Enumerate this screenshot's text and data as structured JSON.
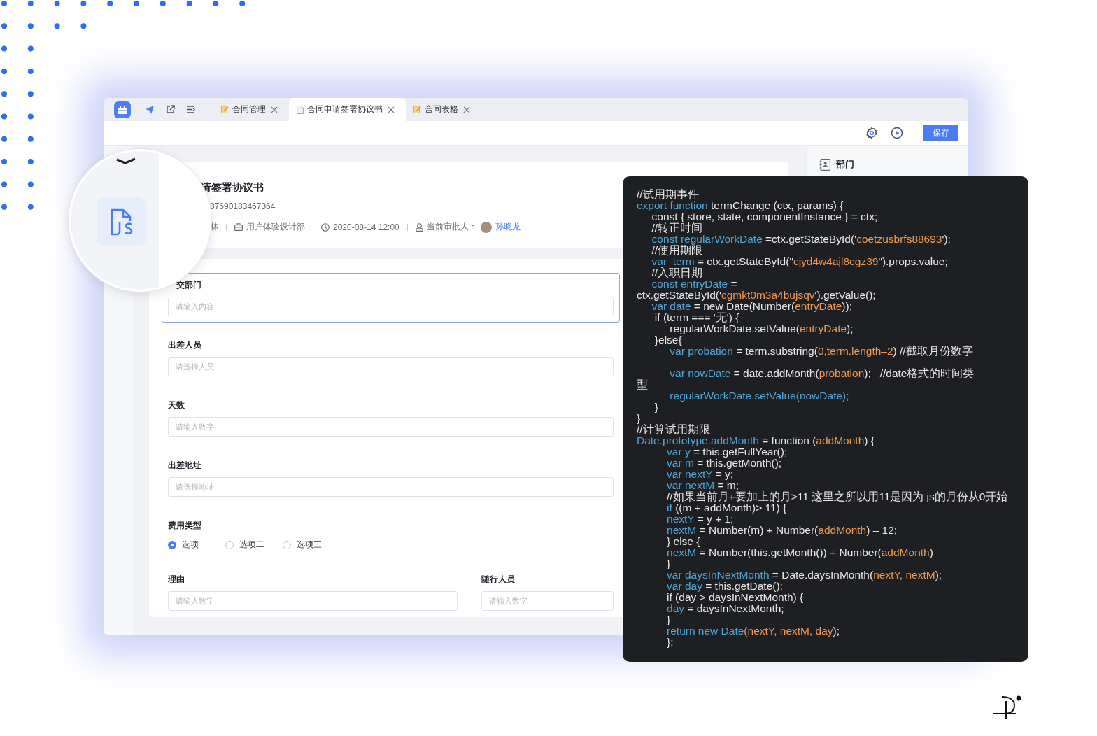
{
  "tab_bar": {
    "tabs": [
      {
        "label": "合同管理",
        "kind": "note",
        "selected": false
      },
      {
        "label": "合同申请签署协议书",
        "kind": "doc",
        "selected": true
      },
      {
        "label": "合同表格",
        "kind": "note",
        "selected": false
      }
    ]
  },
  "toolbar": {
    "save_button": "保存"
  },
  "header": {
    "title": "请签署协议书",
    "number": "87690183467364",
    "meta": [
      {
        "kind": "text",
        "text": "林"
      },
      {
        "kind": "department",
        "text": "用户体验设计部"
      },
      {
        "kind": "time",
        "text": "2020-08-14 12:00"
      },
      {
        "kind": "approver",
        "label": "当前审批人：",
        "name": "孙晓龙"
      }
    ]
  },
  "form": {
    "fields": [
      {
        "kind": "input",
        "label": "交部门",
        "placeholder": "请输入内容",
        "selected": true
      },
      {
        "kind": "input",
        "label": "出差人员",
        "placeholder": "请选择人员",
        "selected": false
      },
      {
        "kind": "input",
        "label": "天数",
        "placeholder": "请输入数字",
        "selected": false
      },
      {
        "kind": "input",
        "label": "出差地址",
        "placeholder": "请选择地址",
        "selected": false
      },
      {
        "kind": "radio",
        "label": "费用类型",
        "selected": false,
        "options": [
          {
            "label": "选项一",
            "selected": true
          },
          {
            "label": "选项二",
            "selected": false
          },
          {
            "label": "选项三",
            "selected": false
          }
        ]
      },
      {
        "kind": "pair",
        "selected": false,
        "items": [
          {
            "label": "理由",
            "placeholder": "请输入数字"
          },
          {
            "label": "随行人员",
            "placeholder": "请输入数字"
          }
        ]
      }
    ]
  },
  "side_panel": {
    "items": [
      {
        "label": "部门"
      }
    ]
  },
  "code_panel": {
    "lines": [
      {
        "segments": [
          {
            "kind": "plain",
            "text": "//试用期事件"
          }
        ]
      },
      {
        "segments": [
          {
            "kind": "keyword",
            "text": "export function"
          },
          {
            "kind": "plain",
            "text": " termChange (ctx, params) {"
          }
        ]
      },
      {
        "segments": [
          {
            "kind": "plain",
            "text": "     const { store, state, componentInstance } = ctx;"
          }
        ]
      },
      {
        "segments": [
          {
            "kind": "plain",
            "text": "     //转正时间"
          }
        ]
      },
      {
        "segments": [
          {
            "kind": "keyword",
            "text": "     const regularWorkDate"
          },
          {
            "kind": "plain",
            "text": " =ctx.getStateById('"
          },
          {
            "kind": "string",
            "text": "coetzusbrfs88693"
          },
          {
            "kind": "plain",
            "text": "');"
          }
        ]
      },
      {
        "segments": [
          {
            "kind": "plain",
            "text": "     //使用期限"
          }
        ]
      },
      {
        "segments": [
          {
            "kind": "keyword",
            "text": "     var  term"
          },
          {
            "kind": "plain",
            "text": " = ctx.getStateById(\""
          },
          {
            "kind": "string",
            "text": "cjyd4w4ajl8cgz39"
          },
          {
            "kind": "plain",
            "text": "\").props.value;"
          }
        ]
      },
      {
        "segments": [
          {
            "kind": "plain",
            "text": "     //入职日期"
          }
        ]
      },
      {
        "segments": [
          {
            "kind": "keyword",
            "text": "     const entryDate"
          },
          {
            "kind": "plain",
            "text": " ="
          }
        ]
      },
      {
        "segments": [
          {
            "kind": "plain",
            "text": "ctx.getStateById('"
          },
          {
            "kind": "string",
            "text": "cgmkt0m3a4bujsqv"
          },
          {
            "kind": "plain",
            "text": "').getValue();"
          }
        ]
      },
      {
        "segments": [
          {
            "kind": "keyword",
            "text": "     var date"
          },
          {
            "kind": "plain",
            "text": " = new Date(Number("
          },
          {
            "kind": "string",
            "text": "entryDate"
          },
          {
            "kind": "plain",
            "text": "));"
          }
        ]
      },
      {
        "segments": [
          {
            "kind": "plain",
            "text": "      if (term === '无') {"
          }
        ]
      },
      {
        "segments": [
          {
            "kind": "plain",
            "text": "           regularWorkDate.setValue("
          },
          {
            "kind": "string",
            "text": "entryDate"
          },
          {
            "kind": "plain",
            "text": ");"
          }
        ]
      },
      {
        "segments": [
          {
            "kind": "plain",
            "text": "      }else{"
          }
        ]
      },
      {
        "segments": [
          {
            "kind": "keyword",
            "text": "           var probation"
          },
          {
            "kind": "plain",
            "text": " = term.substring("
          },
          {
            "kind": "string",
            "text": "0,term.length–2"
          },
          {
            "kind": "plain",
            "text": ") //截取月份数字"
          }
        ]
      },
      {
        "blank_before": true,
        "segments": [
          {
            "kind": "keyword",
            "text": "           var nowDate"
          },
          {
            "kind": "plain",
            "text": " = date.addMonth("
          },
          {
            "kind": "string",
            "text": "probation"
          },
          {
            "kind": "plain",
            "text": ");   //date格式的时间类"
          }
        ]
      },
      {
        "segments": [
          {
            "kind": "plain",
            "text": "型"
          }
        ]
      },
      {
        "segments": [
          {
            "kind": "keyword",
            "text": "           regularWorkDate.setValue(nowDate);"
          }
        ]
      },
      {
        "segments": [
          {
            "kind": "plain",
            "text": "      }"
          }
        ]
      },
      {
        "segments": [
          {
            "kind": "plain",
            "text": "}"
          }
        ]
      },
      {
        "segments": [
          {
            "kind": "plain",
            "text": "//计算试用期限"
          }
        ]
      },
      {
        "segments": [
          {
            "kind": "keyword",
            "text": "Date.prototype.addMonth"
          },
          {
            "kind": "plain",
            "text": " = function ("
          },
          {
            "kind": "string",
            "text": "addMonth"
          },
          {
            "kind": "plain",
            "text": ") {"
          }
        ]
      },
      {
        "segments": [
          {
            "kind": "keyword",
            "text": "          var y"
          },
          {
            "kind": "plain",
            "text": " = this.getFullYear();"
          }
        ]
      },
      {
        "segments": [
          {
            "kind": "keyword",
            "text": "          var m"
          },
          {
            "kind": "plain",
            "text": " = this.getMonth();"
          }
        ]
      },
      {
        "segments": [
          {
            "kind": "keyword",
            "text": "          var nextY"
          },
          {
            "kind": "plain",
            "text": " = y;"
          }
        ]
      },
      {
        "segments": [
          {
            "kind": "keyword",
            "text": "          var nextM"
          },
          {
            "kind": "plain",
            "text": " = m;"
          }
        ]
      },
      {
        "segments": [
          {
            "kind": "plain",
            "text": "          //如果当前月+要加上的月>11 这里之所以用11是因为 js的月份从0开始"
          }
        ]
      },
      {
        "segments": [
          {
            "kind": "keyword",
            "text": "          if"
          },
          {
            "kind": "plain",
            "text": " ((m + addMonth)> 11) {"
          }
        ]
      },
      {
        "segments": [
          {
            "kind": "keyword",
            "text": "          nextY"
          },
          {
            "kind": "plain",
            "text": " = y + 1;"
          }
        ]
      },
      {
        "segments": [
          {
            "kind": "keyword",
            "text": "          nextM"
          },
          {
            "kind": "plain",
            "text": " = Number(m) + Number("
          },
          {
            "kind": "string",
            "text": "addMonth"
          },
          {
            "kind": "plain",
            "text": ") – 12;"
          }
        ]
      },
      {
        "segments": [
          {
            "kind": "plain",
            "text": "          } else {"
          }
        ]
      },
      {
        "segments": [
          {
            "kind": "keyword",
            "text": "          nextM"
          },
          {
            "kind": "plain",
            "text": " = Number(this.getMonth()) + Number("
          },
          {
            "kind": "string",
            "text": "addMonth"
          },
          {
            "kind": "plain",
            "text": ")"
          }
        ]
      },
      {
        "segments": [
          {
            "kind": "plain",
            "text": "          }"
          }
        ]
      },
      {
        "segments": [
          {
            "kind": "keyword",
            "text": "          var daysInNextMonth"
          },
          {
            "kind": "plain",
            "text": " = Date.daysInMonth("
          },
          {
            "kind": "string",
            "text": "nextY, nextM"
          },
          {
            "kind": "plain",
            "text": ");"
          }
        ]
      },
      {
        "segments": [
          {
            "kind": "keyword",
            "text": "          var day"
          },
          {
            "kind": "plain",
            "text": " = this.getDate();"
          }
        ]
      },
      {
        "segments": [
          {
            "kind": "plain",
            "text": "          if (day > daysInNextMonth) {"
          }
        ]
      },
      {
        "segments": [
          {
            "kind": "keyword",
            "text": "          day"
          },
          {
            "kind": "plain",
            "text": " = daysInNextMonth;"
          }
        ]
      },
      {
        "segments": [
          {
            "kind": "plain",
            "text": "          }"
          }
        ]
      },
      {
        "segments": [
          {
            "kind": "keyword",
            "text": "          return new Date"
          },
          {
            "kind": "string",
            "text": "(nextY, nextM, day"
          },
          {
            "kind": "plain",
            "text": ");"
          }
        ]
      },
      {
        "segments": [
          {
            "kind": "plain",
            "text": "          };"
          }
        ]
      }
    ]
  }
}
